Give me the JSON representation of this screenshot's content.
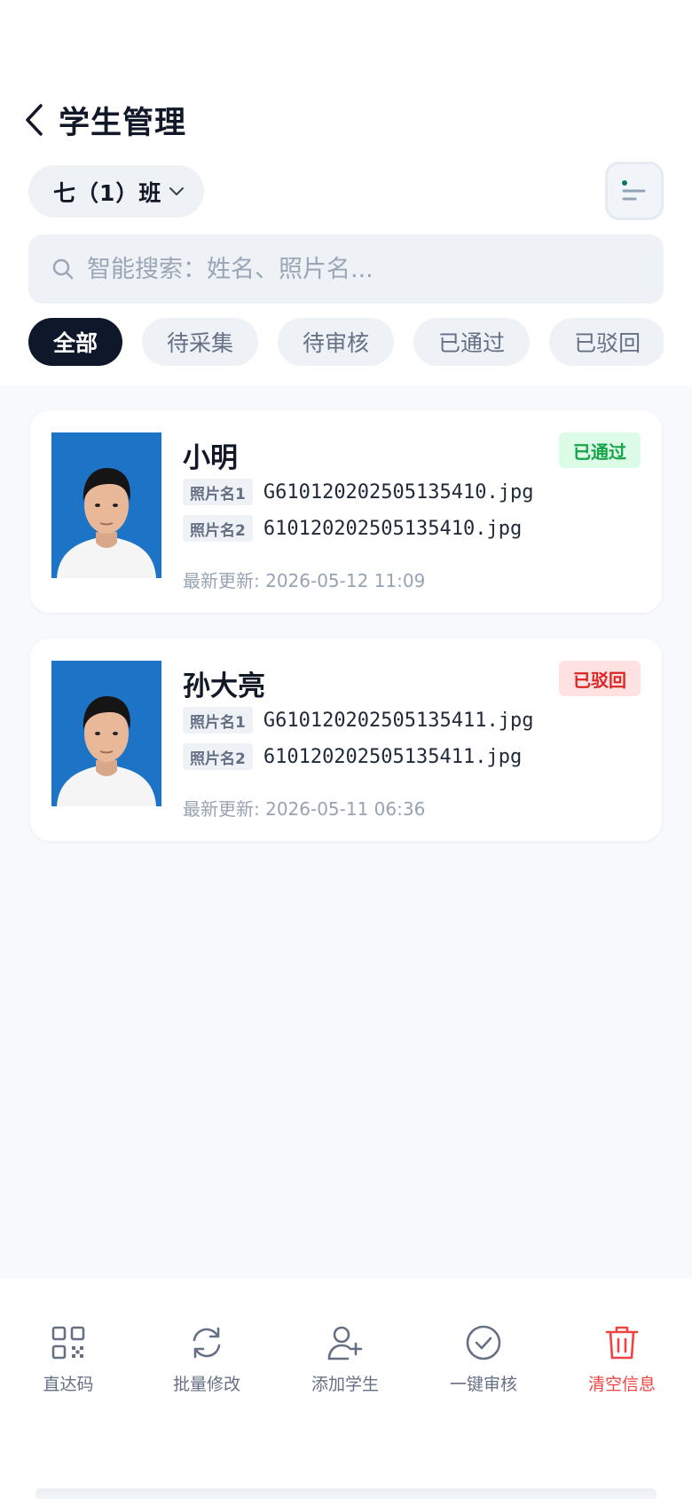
{
  "header": {
    "title": "学生管理",
    "class_label": "七（1）班"
  },
  "search": {
    "placeholder": "智能搜索：姓名、照片名..."
  },
  "tabs": [
    {
      "label": "全部",
      "active": true
    },
    {
      "label": "待采集",
      "active": false
    },
    {
      "label": "待审核",
      "active": false
    },
    {
      "label": "已通过",
      "active": false
    },
    {
      "label": "已驳回",
      "active": false
    }
  ],
  "students": [
    {
      "name": "小明",
      "status": "已通过",
      "status_color": "#16a34a",
      "file1_tag": "照片名1",
      "file1": "G610120202505135410.jpg",
      "file2_tag": "照片名2",
      "file2": "610120202505135410.jpg",
      "updated": "最新更新: 2026-05-12 11:09"
    },
    {
      "name": "孙大亮",
      "status": "已驳回",
      "status_color": "#dc2626",
      "file1_tag": "照片名1",
      "file1": "G610120202505135411.jpg",
      "file2_tag": "照片名2",
      "file2": "610120202505135411.jpg",
      "updated": "最新更新: 2026-05-11 06:36"
    }
  ],
  "toolbar": {
    "items": [
      {
        "label": "直达码",
        "icon": "qr-code-icon"
      },
      {
        "label": "批量修改",
        "icon": "refresh-icon"
      },
      {
        "label": "添加学生",
        "icon": "add-user-icon"
      },
      {
        "label": "一键审核",
        "icon": "check-circle-icon"
      },
      {
        "label": "清空信息",
        "icon": "trash-icon",
        "color": "#ef4444"
      }
    ]
  },
  "colors": {
    "accent_dark": "#0f172a",
    "pass": "#16a34a",
    "reject": "#dc2626",
    "danger": "#ef4444",
    "photo_bg": "#1d74c6"
  }
}
